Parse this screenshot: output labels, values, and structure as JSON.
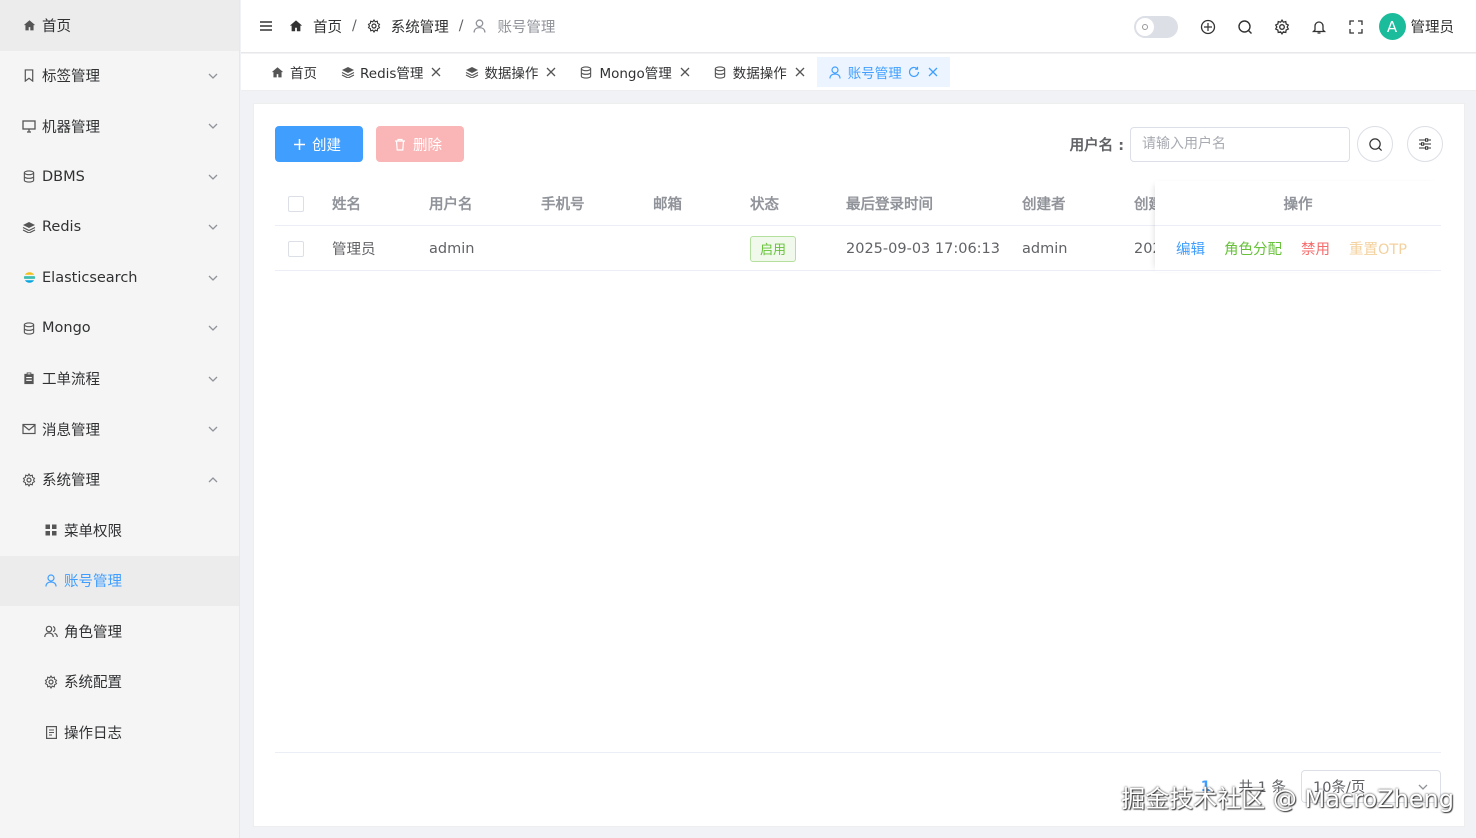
{
  "sidebar": {
    "items": [
      {
        "label": "首页",
        "icon": "home-icon"
      },
      {
        "label": "标签管理",
        "icon": "bookmark-icon"
      },
      {
        "label": "机器管理",
        "icon": "monitor-icon"
      },
      {
        "label": "DBMS",
        "icon": "database-icon"
      },
      {
        "label": "Redis",
        "icon": "stack-icon"
      },
      {
        "label": "Elasticsearch",
        "icon": "elasticsearch-icon"
      },
      {
        "label": "Mongo",
        "icon": "database-icon"
      },
      {
        "label": "工单流程",
        "icon": "clipboard-icon"
      },
      {
        "label": "消息管理",
        "icon": "mail-icon"
      },
      {
        "label": "系统管理",
        "icon": "gear-icon"
      }
    ],
    "sub_items": [
      {
        "label": "菜单权限",
        "icon": "grid-icon"
      },
      {
        "label": "账号管理",
        "icon": "user-icon"
      },
      {
        "label": "角色管理",
        "icon": "users-icon"
      },
      {
        "label": "系统配置",
        "icon": "gear-icon"
      },
      {
        "label": "操作日志",
        "icon": "document-icon"
      }
    ]
  },
  "header": {
    "breadcrumb": [
      "首页",
      "系统管理",
      "账号管理"
    ],
    "username": "管理员",
    "avatar_letter": "A",
    "avatar_color": "#1abc9c"
  },
  "tabs": [
    {
      "label": "首页"
    },
    {
      "label": "Redis管理"
    },
    {
      "label": "数据操作"
    },
    {
      "label": "Mongo管理"
    },
    {
      "label": "数据操作"
    },
    {
      "label": "账号管理"
    }
  ],
  "toolbar": {
    "create_label": "创建",
    "delete_label": "删除",
    "search_label": "用户名 :",
    "search_placeholder": "请输入用户名"
  },
  "table": {
    "headers": [
      "姓名",
      "用户名",
      "手机号",
      "邮箱",
      "状态",
      "最后登录时间",
      "创建者",
      "创建",
      "操作"
    ],
    "rows": [
      {
        "name": "管理员",
        "username": "admin",
        "phone": "",
        "email": "",
        "status": "启用",
        "last_login": "2025-09-03 17:06:13",
        "creator": "admin",
        "created": "202",
        "ops": [
          "编辑",
          "角色分配",
          "禁用",
          "重置OTP"
        ]
      }
    ]
  },
  "pagination": {
    "current_page": "1",
    "total": "共 1 条",
    "page_size": "10条/页"
  },
  "watermark": "掘金技术社区 @ MacroZheng",
  "colors": {
    "primary": "#409eff",
    "success": "#67c23a",
    "danger": "#f56c6c",
    "warning": "#f3d19e"
  }
}
